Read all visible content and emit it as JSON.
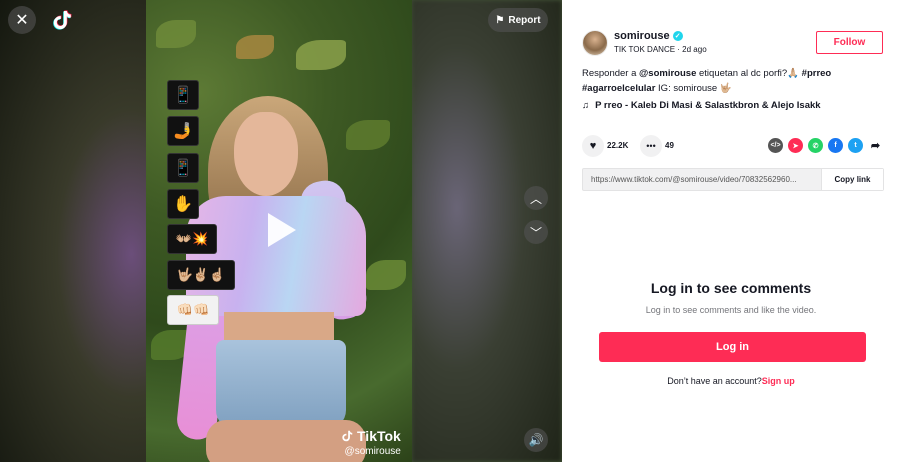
{
  "colors": {
    "accent": "#fe2c55",
    "verified": "#20d5ec"
  },
  "video": {
    "close_icon": "close-icon",
    "report_label": "Report",
    "watermark_brand": "TikTok",
    "watermark_handle": "@somirouse",
    "overlay_emojis": [
      "📱",
      "🤳",
      "📱",
      "✋",
      "👐🏼💥",
      "🤟🏼✌🏼☝🏼",
      "👊🏻👊🏻"
    ]
  },
  "author": {
    "username": "somirouse",
    "subtitle_name": "TIK TOK DANCE",
    "separator": " · ",
    "posted": "2d ago",
    "follow_label": "Follow"
  },
  "caption": {
    "prefix": "Responder a ",
    "mention": "@somirouse",
    "text_after_mention": " etiquetan al dc porfi?🙏🏼 ",
    "hashtag1": "#prreo",
    "hashtag2": "#agarroelcelular",
    "suffix": " IG: somirouse 🤟🏼"
  },
  "music": {
    "icon": "♫",
    "title": "P rreo - Kaleb Di Masi & Salastkbron & Alejo Isakk"
  },
  "stats": {
    "likes": "22.2K",
    "comments": "49"
  },
  "share": {
    "link": "https://www.tiktok.com/@somirouse/video/70832562960...",
    "copy_label": "Copy link"
  },
  "login": {
    "title": "Log in to see comments",
    "subtitle": "Log in to see comments and like the video.",
    "button_label": "Log in",
    "no_account_text": "Don’t have an account?",
    "signup_label": "Sign up"
  }
}
